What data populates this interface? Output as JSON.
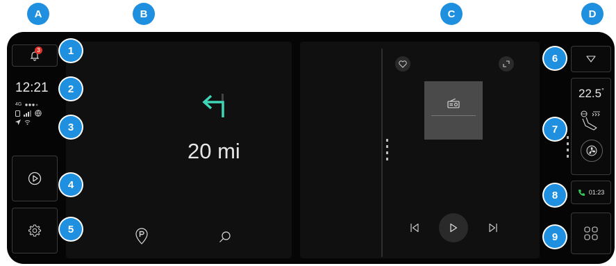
{
  "zones": {
    "a": "A",
    "b": "B",
    "c": "C",
    "d": "D"
  },
  "callouts": [
    "1",
    "2",
    "3",
    "4",
    "5",
    "6",
    "7",
    "8",
    "9"
  ],
  "status": {
    "clock": "12:21",
    "network": "4G",
    "notification_count": "3"
  },
  "navigation": {
    "distance": "20 mi",
    "arrow_color": "#3fd6b8"
  },
  "climate": {
    "temperature": "22.5",
    "unit": "°"
  },
  "call": {
    "duration": "01:23",
    "icon_color": "#35c759"
  },
  "colors": {
    "marker": "#1f8fe0",
    "badge": "#e0342b",
    "background": "#050505"
  },
  "icons": [
    "bell-icon",
    "signal-icon",
    "play-circle-icon",
    "gear-icon",
    "parking-icon",
    "search-icon",
    "close-icon",
    "heart-icon",
    "expand-icon",
    "radio-icon",
    "skip-back-icon",
    "play-icon",
    "skip-forward-icon",
    "chevron-down-icon",
    "fan-icon",
    "phone-icon",
    "apps-grid-icon"
  ]
}
